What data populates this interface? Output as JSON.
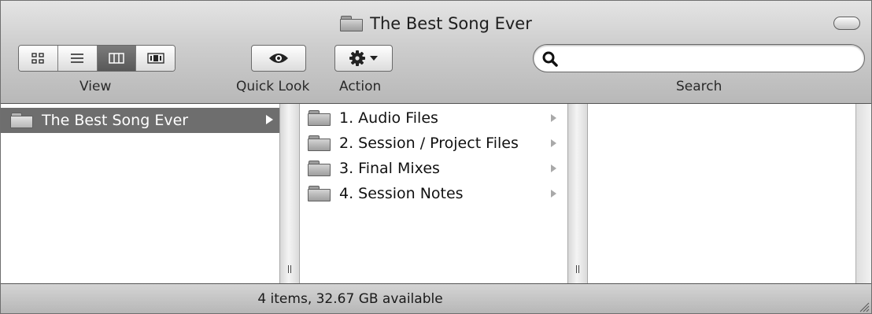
{
  "window": {
    "title": "The Best Song Ever"
  },
  "toolbar": {
    "view_label": "View",
    "view_modes": [
      {
        "name": "icon-view",
        "icon": "icon-grid-icon",
        "active": false
      },
      {
        "name": "list-view",
        "icon": "list-lines-icon",
        "active": false
      },
      {
        "name": "column-view",
        "icon": "columns-icon",
        "active": true
      },
      {
        "name": "coverflow-view",
        "icon": "coverflow-icon",
        "active": false
      }
    ],
    "quicklook_label": "Quick Look",
    "quicklook_icon": "eye-icon",
    "action_label": "Action",
    "action_icon": "gear-icon",
    "search_label": "Search",
    "search_value": "",
    "search_icon": "magnifier-icon"
  },
  "columns": [
    {
      "items": [
        {
          "label": "The Best Song Ever",
          "selected": true,
          "has_children": true
        }
      ]
    },
    {
      "items": [
        {
          "label": "1. Audio Files",
          "has_children": true
        },
        {
          "label": "2. Session / Project Files",
          "has_children": true
        },
        {
          "label": "3. Final Mixes",
          "has_children": true
        },
        {
          "label": "4. Session Notes",
          "has_children": true
        }
      ]
    },
    {
      "items": []
    }
  ],
  "status": {
    "text": "4 items, 32.67 GB available"
  },
  "colors": {
    "selection": "#6e6e6e",
    "toolbar_top": "#e4e4e4",
    "toolbar_bottom": "#b8b8b8"
  }
}
